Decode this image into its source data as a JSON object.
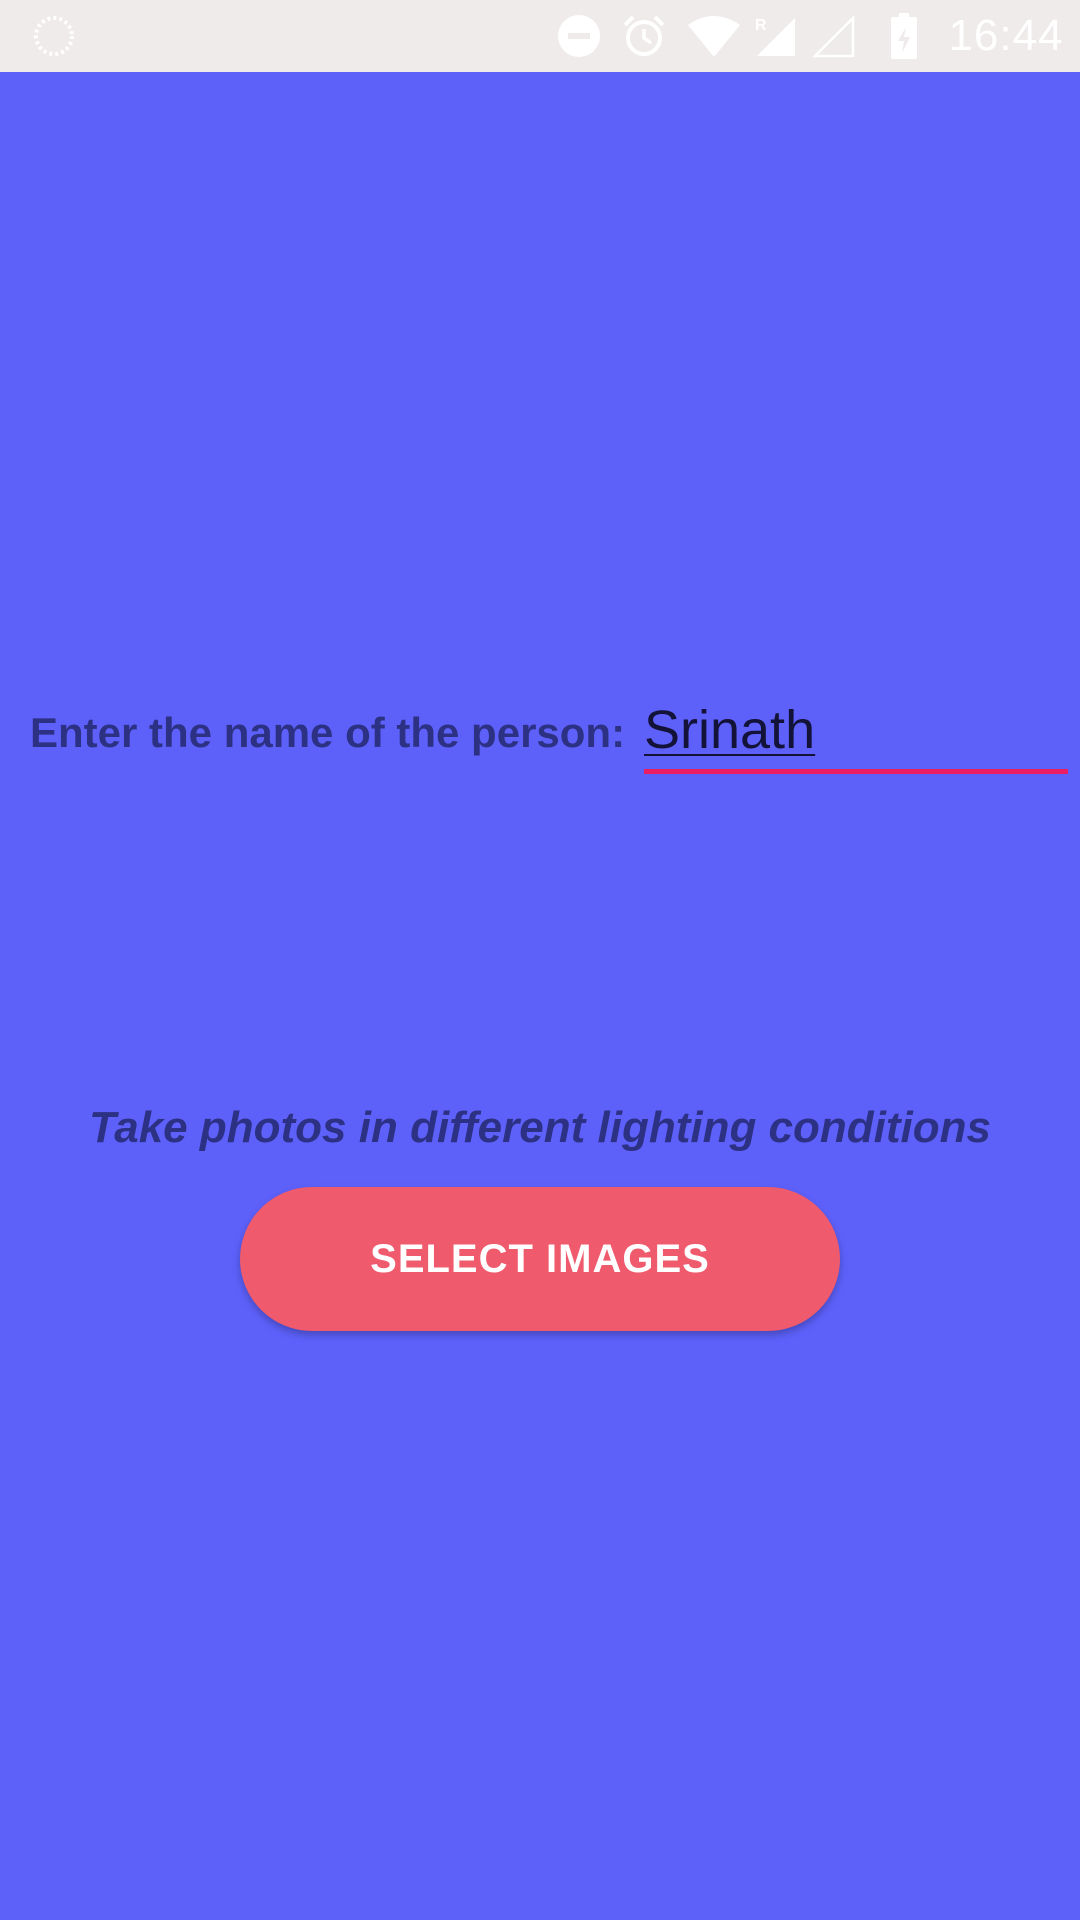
{
  "status_bar": {
    "time": "16:44",
    "icons": [
      "loading-icon",
      "do-not-disturb-icon",
      "alarm-icon",
      "wifi-icon",
      "signal-roaming-icon",
      "signal-empty-icon",
      "battery-charging-icon"
    ]
  },
  "form": {
    "name_label": "Enter the name of the person:",
    "name_value": "Srinath"
  },
  "instruction": "Take photos in different lighting conditions",
  "button": {
    "select_images_label": "SELECT IMAGES"
  },
  "colors": {
    "background": "#5d61fa",
    "status_bar": "#efebea",
    "label_text": "#2d3183",
    "field_underline": "#e91e63",
    "button": "#ef5a6d",
    "button_text": "#ffffff"
  }
}
